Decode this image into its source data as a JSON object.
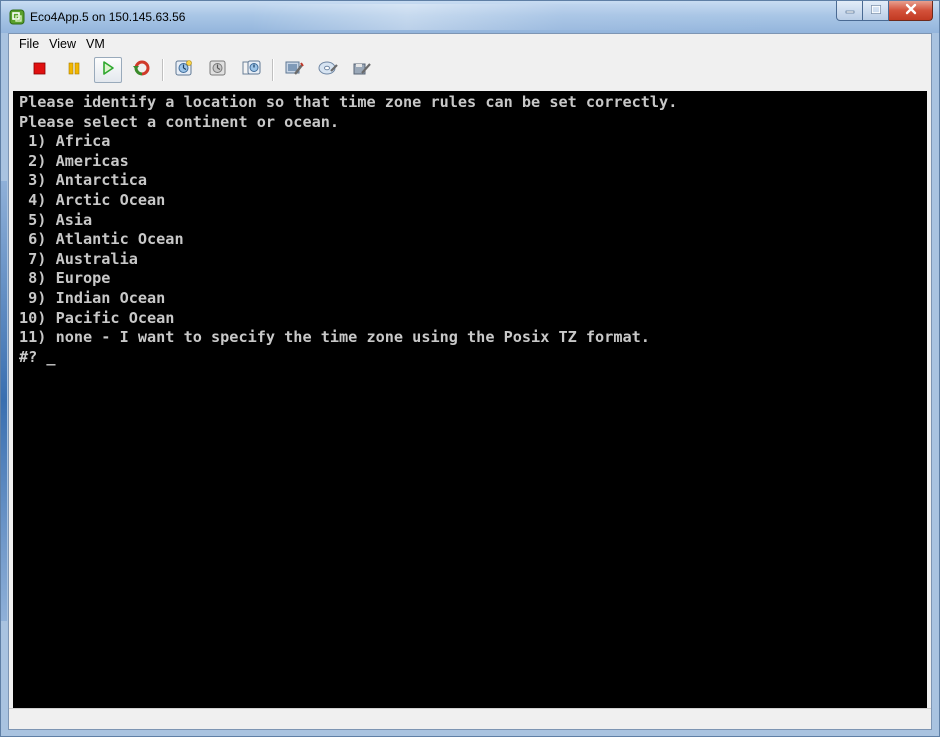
{
  "window": {
    "title": "Eco4App.5 on 150.145.63.56",
    "icon": "vmware-console-icon",
    "caption_buttons": [
      "minimize-icon",
      "maximize-icon",
      "close-icon"
    ]
  },
  "menubar": {
    "items": [
      {
        "label": "File",
        "name": "menu-file"
      },
      {
        "label": "View",
        "name": "menu-view"
      },
      {
        "label": "VM",
        "name": "menu-vm"
      }
    ]
  },
  "toolbar": {
    "buttons": [
      {
        "name": "power-off-button",
        "icon": "stop-icon",
        "color": "#e01010"
      },
      {
        "name": "suspend-button",
        "icon": "pause-icon",
        "color": "#f2b600"
      },
      {
        "name": "power-on-button",
        "icon": "play-icon",
        "color": "#2fa82f"
      },
      {
        "name": "reset-button",
        "icon": "reset-icon",
        "color": "#d03a2a"
      },
      {
        "name": "snapshot-button",
        "icon": "snapshot-icon"
      },
      {
        "name": "revert-snapshot-button",
        "icon": "revert-icon"
      },
      {
        "name": "snapshot-manager-button",
        "icon": "snapshot-manager-icon"
      },
      {
        "name": "edit-settings-button",
        "icon": "settings-icon"
      },
      {
        "name": "connect-cd-button",
        "icon": "cd-icon"
      },
      {
        "name": "connect-floppy-button",
        "icon": "floppy-icon"
      }
    ]
  },
  "console": {
    "lines": [
      "Please identify a location so that time zone rules can be set correctly.",
      "Please select a continent or ocean.",
      " 1) Africa",
      " 2) Americas",
      " 3) Antarctica",
      " 4) Arctic Ocean",
      " 5) Asia",
      " 6) Atlantic Ocean",
      " 7) Australia",
      " 8) Europe",
      " 9) Indian Ocean",
      "10) Pacific Ocean",
      "11) none - I want to specify the time zone using the Posix TZ format.",
      "#? _"
    ]
  },
  "colors": {
    "console_bg": "#000000",
    "console_fg": "#c8c8c8",
    "titlebar": "#a9c6e6"
  }
}
